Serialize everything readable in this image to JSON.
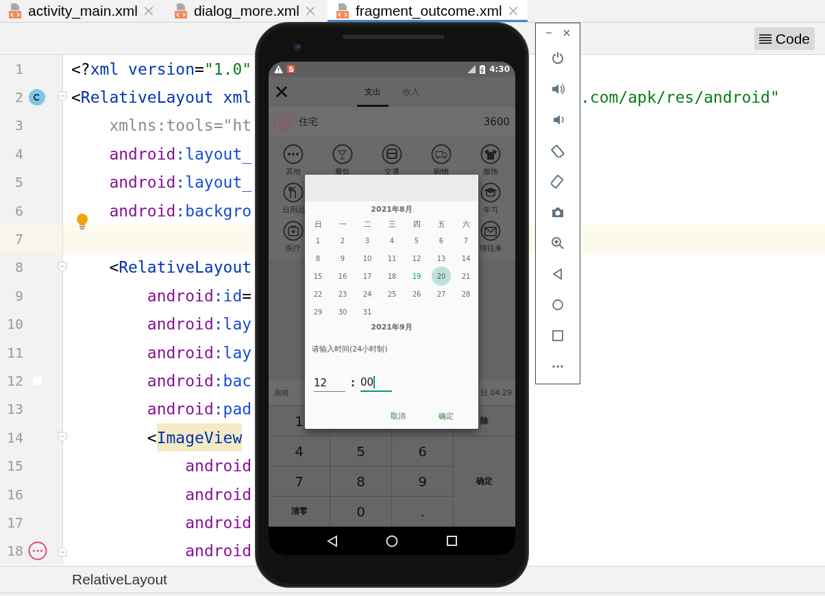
{
  "editor_tabs": [
    {
      "label": "activity_main.xml",
      "selected": false
    },
    {
      "label": "dialog_more.xml",
      "selected": false
    },
    {
      "label": "fragment_outcome.xml",
      "selected": true
    }
  ],
  "view_modes": [
    {
      "label": "Code",
      "selected": true
    }
  ],
  "code_lines": [
    {
      "number": "1",
      "current": false,
      "kind": "top",
      "segments": [
        {
          "kind": "punct",
          "text": "<?"
        },
        {
          "kind": "tag",
          "text": "xml version"
        },
        {
          "kind": "punct",
          "text": "="
        },
        {
          "kind": "value",
          "text": "\"1.0\""
        }
      ]
    },
    {
      "number": "2",
      "current": false,
      "kind": "top",
      "marker": {
        "kind": "class"
      },
      "fold": {
        "kind": "start"
      },
      "segments": [
        {
          "kind": "punct",
          "text": "<"
        },
        {
          "kind": "tag",
          "text": "RelativeLayout xml"
        }
      ],
      "tail": {
        "kind": "value",
        "text": ".com/apk/res/android\""
      }
    },
    {
      "number": "3",
      "current": false,
      "kind": "nested",
      "segments": [
        {
          "kind": "unused",
          "text": "xmlns:tools=\"ht"
        }
      ]
    },
    {
      "number": "4",
      "current": false,
      "kind": "nested",
      "segments": [
        {
          "kind": "ns",
          "text": "android"
        },
        {
          "kind": "attr",
          "text": ":layout_"
        }
      ]
    },
    {
      "number": "5",
      "current": false,
      "kind": "nested",
      "segments": [
        {
          "kind": "ns",
          "text": "android"
        },
        {
          "kind": "attr",
          "text": ":layout_"
        }
      ]
    },
    {
      "number": "6",
      "current": false,
      "kind": "nested",
      "marker": {
        "kind": "bulb"
      },
      "segments": [
        {
          "kind": "ns",
          "text": "android"
        },
        {
          "kind": "attr",
          "text": ":backgro"
        }
      ]
    },
    {
      "number": "7",
      "current": true,
      "kind": "top"
    },
    {
      "number": "8",
      "current": false,
      "kind": "nested",
      "fold": {
        "kind": "start"
      },
      "segments": [
        {
          "kind": "punct",
          "text": "<"
        },
        {
          "kind": "tag",
          "text": "RelativeLayout"
        }
      ]
    },
    {
      "number": "9",
      "current": false,
      "kind": "deep",
      "segments": [
        {
          "kind": "ns",
          "text": "android"
        },
        {
          "kind": "attr",
          "text": ":id"
        },
        {
          "kind": "punct",
          "text": "="
        }
      ]
    },
    {
      "number": "10",
      "current": false,
      "kind": "deep",
      "segments": [
        {
          "kind": "ns",
          "text": "android"
        },
        {
          "kind": "attr",
          "text": ":lay"
        }
      ]
    },
    {
      "number": "11",
      "current": false,
      "kind": "deep",
      "segments": [
        {
          "kind": "ns",
          "text": "android"
        },
        {
          "kind": "attr",
          "text": ":lay"
        }
      ]
    },
    {
      "number": "12",
      "current": false,
      "kind": "deep",
      "marker": {
        "kind": "color"
      },
      "segments": [
        {
          "kind": "ns",
          "text": "android"
        },
        {
          "kind": "attr",
          "text": ":bac"
        }
      ]
    },
    {
      "number": "13",
      "current": false,
      "kind": "deep",
      "segments": [
        {
          "kind": "ns",
          "text": "android"
        },
        {
          "kind": "attr",
          "text": ":pad"
        }
      ]
    },
    {
      "number": "14",
      "current": false,
      "kind": "deep",
      "fold": {
        "kind": "start"
      },
      "segments": [
        {
          "kind": "punct",
          "text": "<"
        },
        {
          "kind": "match",
          "text": "ImageView"
        }
      ]
    },
    {
      "number": "15",
      "current": false,
      "kind": "deeper",
      "segments": [
        {
          "kind": "ns",
          "text": "android"
        }
      ]
    },
    {
      "number": "16",
      "current": false,
      "kind": "deeper",
      "segments": [
        {
          "kind": "ns",
          "text": "android"
        }
      ]
    },
    {
      "number": "17",
      "current": false,
      "kind": "deeper",
      "segments": [
        {
          "kind": "ns",
          "text": "android"
        }
      ]
    },
    {
      "number": "18",
      "current": false,
      "kind": "deeper",
      "marker": {
        "kind": "more"
      },
      "fold": {
        "kind": "end"
      },
      "segments": [
        {
          "kind": "ns",
          "text": "android"
        }
      ]
    }
  ],
  "status_bar": {
    "breadcrumb": "RelativeLayout"
  },
  "emulator": {
    "status_bar": {
      "time": "4:30"
    },
    "tabs": [
      {
        "label": "支出",
        "selected": true
      },
      {
        "label": "收入",
        "selected": false
      }
    ],
    "header_row": {
      "name": "住宅",
      "amount": "3600"
    },
    "categories": [
      [
        {
          "label": "其他"
        },
        {
          "label": "餐饮"
        },
        {
          "label": "交通"
        },
        {
          "label": "购物"
        },
        {
          "label": "服饰"
        }
      ],
      [
        {
          "label": "日用品"
        },
        {
          "label": "学习"
        }
      ],
      [
        {
          "label": "医疗"
        },
        {
          "label": "情往来"
        }
      ]
    ],
    "note_row": {
      "label": "房租",
      "date": "日 04:29"
    },
    "keypad": {
      "rows": [
        [
          "1"
        ],
        [
          "4",
          "5",
          "6"
        ],
        [
          "7",
          "8",
          "9"
        ],
        [
          "清零",
          "0",
          "."
        ]
      ],
      "delete": "除",
      "confirm": "确定"
    },
    "dialog": {
      "month": "2021年8月",
      "weekdays": [
        "日",
        "一",
        "二",
        "三",
        "四",
        "五",
        "六"
      ],
      "days": [
        {
          "label": "1",
          "selected": false,
          "today": false
        },
        {
          "label": "2",
          "selected": false,
          "today": false
        },
        {
          "label": "3",
          "selected": false,
          "today": false
        },
        {
          "label": "4",
          "selected": false,
          "today": false
        },
        {
          "label": "5",
          "selected": false,
          "today": false
        },
        {
          "label": "6",
          "selected": false,
          "today": false
        },
        {
          "label": "7",
          "selected": false,
          "today": false
        },
        {
          "label": "8",
          "selected": false,
          "today": false
        },
        {
          "label": "9",
          "selected": false,
          "today": false
        },
        {
          "label": "10",
          "selected": false,
          "today": false
        },
        {
          "label": "11",
          "selected": false,
          "today": false
        },
        {
          "label": "12",
          "selected": false,
          "today": false
        },
        {
          "label": "13",
          "selected": false,
          "today": false
        },
        {
          "label": "14",
          "selected": false,
          "today": false
        },
        {
          "label": "15",
          "selected": false,
          "today": false
        },
        {
          "label": "16",
          "selected": false,
          "today": false
        },
        {
          "label": "17",
          "selected": false,
          "today": false
        },
        {
          "label": "18",
          "selected": false,
          "today": false
        },
        {
          "label": "19",
          "selected": false,
          "today": true
        },
        {
          "label": "20",
          "selected": true,
          "today": false
        },
        {
          "label": "21",
          "selected": false,
          "today": false
        },
        {
          "label": "22",
          "selected": false,
          "today": false
        },
        {
          "label": "23",
          "selected": false,
          "today": false
        },
        {
          "label": "24",
          "selected": false,
          "today": false
        },
        {
          "label": "25",
          "selected": false,
          "today": false
        },
        {
          "label": "26",
          "selected": false,
          "today": false
        },
        {
          "label": "27",
          "selected": false,
          "today": false
        },
        {
          "label": "28",
          "selected": false,
          "today": false
        },
        {
          "label": "29",
          "selected": false,
          "today": false
        },
        {
          "label": "30",
          "selected": false,
          "today": false
        },
        {
          "label": "31",
          "selected": false,
          "today": false
        }
      ],
      "next_month": "2021年9月",
      "time_label": "请输入时间(24小时制)",
      "time_fields": [
        {
          "value": "12",
          "focused": false
        },
        {
          "value": "00",
          "focused": true
        }
      ],
      "separator": ":",
      "buttons": [
        "取消",
        "确定"
      ]
    }
  }
}
